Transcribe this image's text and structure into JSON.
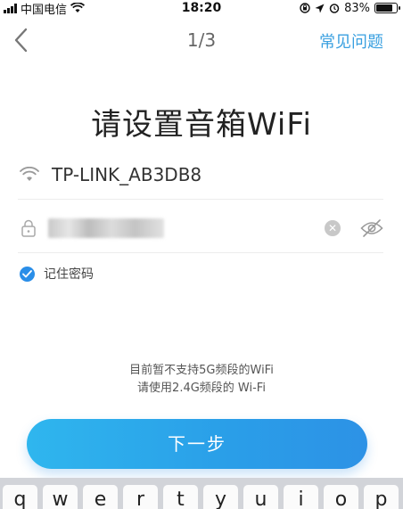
{
  "status_bar": {
    "carrier": "中国电信",
    "time": "18:20",
    "battery_percent": "83%",
    "battery_level": 0.83,
    "icons": [
      "signal-icon",
      "wifi-icon",
      "lock-rotation-icon",
      "location-icon",
      "alarm-icon",
      "battery-icon"
    ]
  },
  "nav": {
    "back_icon": "chevron-left-icon",
    "step": "1/3",
    "faq_label": "常见问题"
  },
  "page": {
    "heading": "请设置音箱WiFi"
  },
  "wifi_form": {
    "ssid_icon": "wifi-icon",
    "ssid": "TP-LINK_AB3DB8",
    "password_icon": "lock-icon",
    "password_value": "",
    "clear_icon": "clear-icon",
    "visibility_icon": "eye-off-icon",
    "remember_label": "记住密码",
    "remember_checked": true
  },
  "notice": {
    "line1": "目前暂不支持5G频段的WiFi",
    "line2": "请使用2.4G频段的 Wi-Fi"
  },
  "actions": {
    "next_label": "下一步"
  },
  "keyboard": {
    "row1": [
      "q",
      "w",
      "e",
      "r",
      "t",
      "y",
      "u",
      "i",
      "o",
      "p"
    ]
  },
  "colors": {
    "accent": "#2a9ee8",
    "link": "#3aa0e0",
    "checkbox": "#2a8ee8"
  }
}
